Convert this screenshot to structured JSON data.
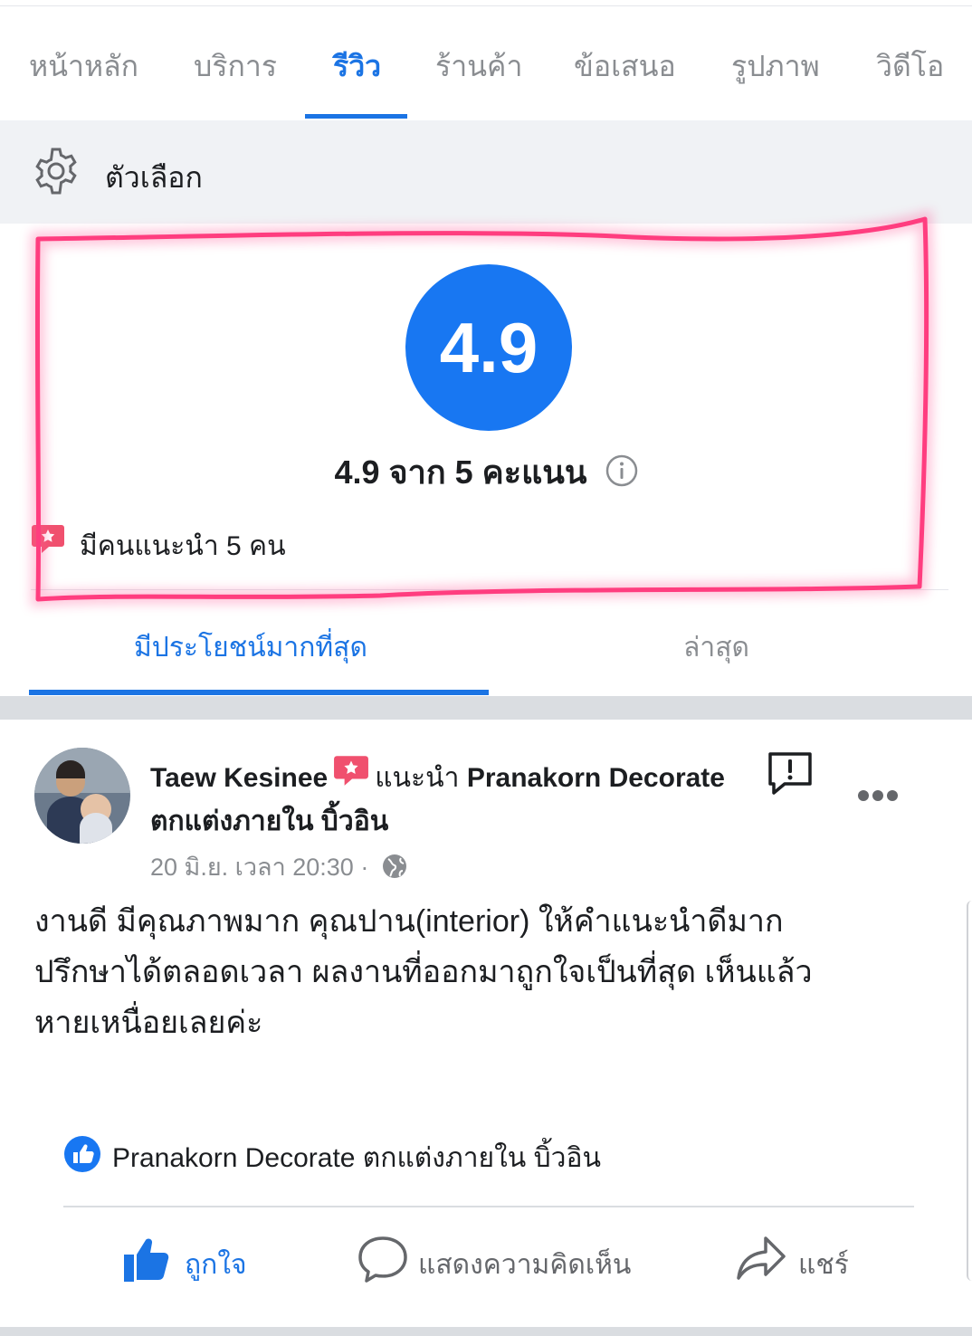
{
  "tabs": [
    {
      "label": "หน้าหลัก",
      "active": false
    },
    {
      "label": "บริการ",
      "active": false
    },
    {
      "label": "รีวิว",
      "active": true
    },
    {
      "label": "ร้านค้า",
      "active": false
    },
    {
      "label": "ข้อเสนอ",
      "active": false
    },
    {
      "label": "รูปภาพ",
      "active": false
    },
    {
      "label": "วิดีโอ",
      "active": false
    }
  ],
  "options": {
    "label": "ตัวเลือก",
    "icon": "gear-icon"
  },
  "rating": {
    "score": "4.9",
    "summary": "4.9 จาก 5 คะแนน",
    "recommend_text": "มีคนแนะนำ 5 คน"
  },
  "sort_tabs": {
    "most_helpful": "มีประโยชน์มากที่สุด",
    "latest": "ล่าสุด"
  },
  "review": {
    "author": "Taew Kesinee",
    "verb": "แนะนำ",
    "page_name": "Pranakorn Decorate ตกแต่งภายใน บิ้วอิน",
    "timestamp": "20 มิ.ย. เวลา 20:30",
    "separator": "·",
    "body_lines": [
      "งานดี มีคุณภาพมาก คุณปาน(interior) ให้คำแนะนำดีมาก",
      "ปรึกษาได้ตลอดเวลา ผลงานที่ออกมาถูกใจเป็นที่สุด เห็นแล้ว",
      "หายเหนื่อยเลยค่ะ"
    ],
    "liked_by": "Pranakorn Decorate ตกแต่งภายใน บิ้วอิน"
  },
  "actions": {
    "like": "ถูกใจ",
    "comment": "แสดงความคิดเห็น",
    "share": "แชร์"
  },
  "colors": {
    "accent": "#1b74e4",
    "rating_circle": "#1877f2",
    "recommend_badge": "#f0506e",
    "highlight": "#ff3d7f"
  }
}
